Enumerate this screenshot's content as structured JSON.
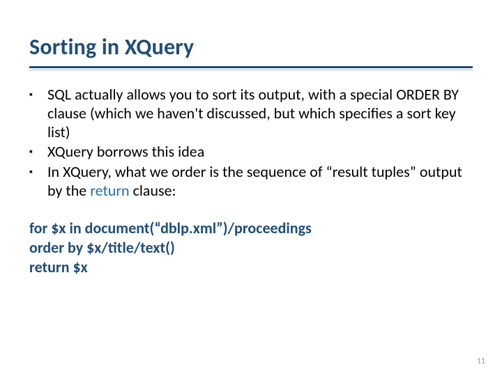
{
  "title": "Sorting in XQuery",
  "bullets": [
    {
      "pre": "SQL actually allows you to sort its output, with a special ORDER BY clause (which we haven't discussed, but which specifies a sort key list)",
      "kw": "",
      "post": ""
    },
    {
      "pre": "XQuery borrows this idea",
      "kw": "",
      "post": ""
    },
    {
      "pre": "In XQuery, what we order is the sequence of “result tuples” output by the ",
      "kw": "return",
      "post": " clause:"
    }
  ],
  "code_lines": [
    "for $x in document(“dblp.xml”)/proceedings",
    "order by $x/title/text()",
    "return $x"
  ],
  "page_number": "11"
}
